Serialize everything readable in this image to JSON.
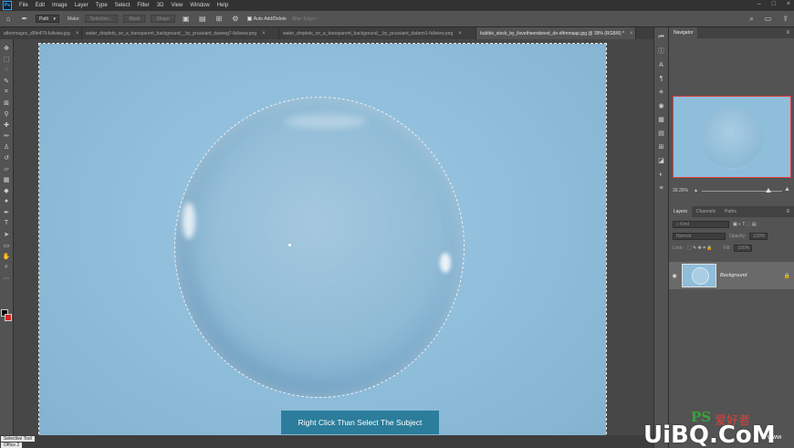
{
  "app": {
    "logo": "Ps"
  },
  "menu": [
    "File",
    "Edit",
    "Image",
    "Layer",
    "Type",
    "Select",
    "Filter",
    "3D",
    "View",
    "Window",
    "Help"
  ],
  "window_controls": [
    "–",
    "□",
    "×"
  ],
  "options_bar": {
    "mode_select": "Path",
    "make_label": "Make:",
    "selection_btn": "Selection...",
    "mask_btn": "Mask",
    "shape_btn": "Shape",
    "auto_add_delete": "Auto Add/Delete",
    "align_edges": "Align Edges"
  },
  "tabs": [
    {
      "label": "afterimages_d5fe479-fullview.jpg",
      "active": false
    },
    {
      "label": "water_droplets_on_a_transparent_background__by_prussiant_daseeg7-fullview.png",
      "active": false
    },
    {
      "label": "water_droplets_on_a_transparent_background__by_prussiant_datarm1-fullview.png",
      "active": false
    },
    {
      "label": "bubble_stock_by_ilovetheersbeest_de-d4mmaap.jpg @ 39% (RGB/8) *",
      "active": true
    }
  ],
  "canvas": {
    "caption": "Right Click Than Select The Subject"
  },
  "status": {
    "selection_tool": "Selective Tool",
    "sub": "Office 2"
  },
  "navigator": {
    "tab": "Navigator",
    "zoom": "39.26%"
  },
  "layers_panel": {
    "tabs": [
      "Layers",
      "Channels",
      "Paths"
    ],
    "kind": "Kind",
    "blend_mode": "Normal",
    "opacity_label": "Opacity:",
    "opacity": "100%",
    "lock_label": "Lock:",
    "fill_label": "Fill:",
    "fill": "100%",
    "layer_name": "Background"
  },
  "watermark": {
    "ps": "PS",
    "cn": "爱好者",
    "main": "UiBQ.CoM",
    "com": "www"
  },
  "colors": {
    "accent": "#2b7d9b",
    "foreground": "#000000",
    "background": "#d6261f"
  }
}
